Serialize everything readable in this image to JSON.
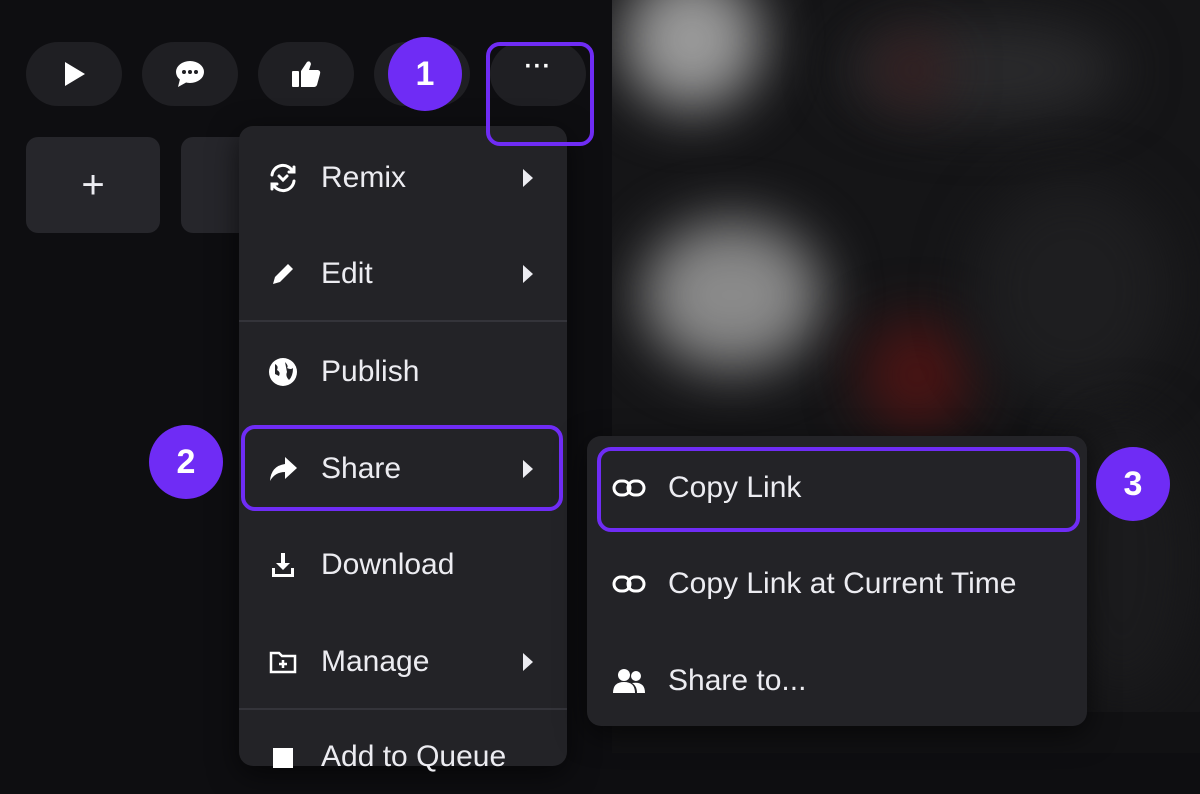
{
  "toolbar": {
    "buttons": [
      {
        "icon": "play-icon"
      },
      {
        "icon": "comment-icon"
      },
      {
        "icon": "thumbs-up-icon"
      },
      {
        "icon": "hidden-button"
      },
      {
        "icon": "more-options-icon",
        "label": "···"
      }
    ],
    "tiles": [
      {
        "label": "+"
      },
      {
        "label": ""
      }
    ]
  },
  "menu": {
    "items": [
      {
        "label": "Remix",
        "icon": "remix-icon",
        "submenu": true
      },
      {
        "label": "Edit",
        "icon": "pencil-icon",
        "submenu": true
      },
      {
        "label": "Publish",
        "icon": "globe-icon",
        "submenu": false
      },
      {
        "label": "Share",
        "icon": "share-icon",
        "submenu": true
      },
      {
        "label": "Download",
        "icon": "download-icon",
        "submenu": false
      },
      {
        "label": "Manage",
        "icon": "folder-icon",
        "submenu": true
      },
      {
        "label": "Add to Queue",
        "icon": "queue-icon",
        "submenu": false
      }
    ]
  },
  "share_submenu": {
    "items": [
      {
        "label": "Copy Link",
        "icon": "link-icon"
      },
      {
        "label": "Copy Link at Current Time",
        "icon": "link-icon"
      },
      {
        "label": "Share to...",
        "icon": "users-icon"
      }
    ]
  },
  "annotations": [
    {
      "number": "1",
      "target": "more-options"
    },
    {
      "number": "2",
      "target": "Share"
    },
    {
      "number": "3",
      "target": "Copy Link"
    }
  ],
  "colors": {
    "accent": "#6f2cf5",
    "background": "#0e0e11",
    "menu": "#232327",
    "text": "#ececf1"
  }
}
